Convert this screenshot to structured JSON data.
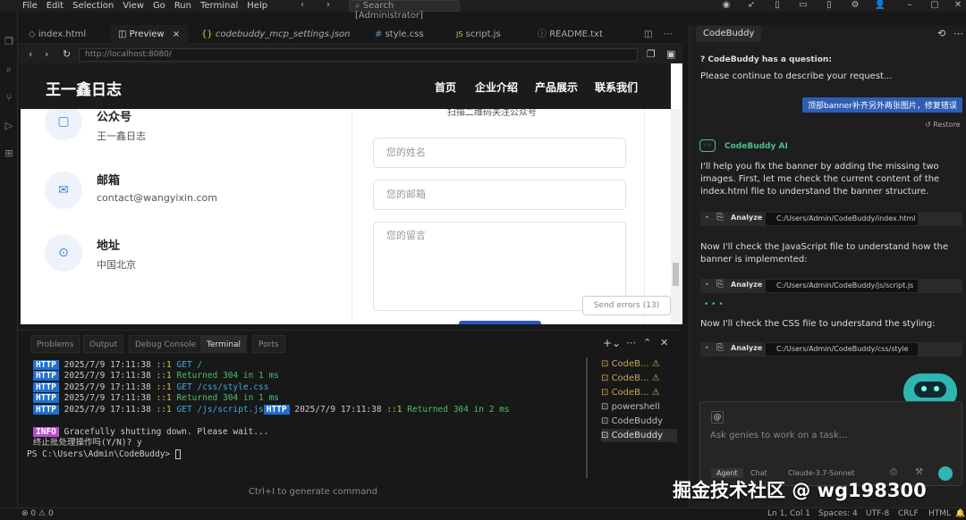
{
  "menu": [
    "File",
    "Edit",
    "Selection",
    "View",
    "Go",
    "Run",
    "Terminal",
    "Help"
  ],
  "search_text": "Search [Administrator]",
  "tabs": [
    {
      "icon": "◇",
      "label": "index.html",
      "close": ""
    },
    {
      "icon": "◫",
      "label": "Preview",
      "close": "×"
    },
    {
      "icon": "{}",
      "label": "codebuddy_mcp_settings.json",
      "close": ""
    },
    {
      "icon": "#",
      "label": "style.css",
      "close": ""
    },
    {
      "icon": "JS",
      "label": "script.js",
      "close": ""
    },
    {
      "icon": "ⓘ",
      "label": "README.txt",
      "close": ""
    }
  ],
  "url": "http://localhost:8080/",
  "site": {
    "logo": "王一鑫日志",
    "nav": [
      "首页",
      "企业介绍",
      "产品展示",
      "联系我们"
    ],
    "qr_caption": "扫描二维码关注公众号",
    "contacts": [
      {
        "title": "公众号",
        "value": "王一鑫日志",
        "icon": "▢"
      },
      {
        "title": "邮箱",
        "value": "contact@wangyixin.com",
        "icon": "✉"
      },
      {
        "title": "地址",
        "value": "中国北京",
        "icon": "⊙"
      }
    ],
    "placeholders": {
      "name": "您的姓名",
      "email": "您的邮箱",
      "message": "您的留言"
    },
    "send_errors": "Send errors (13)"
  },
  "panel": {
    "tabs": [
      "Problems",
      "Output",
      "Debug Console",
      "Terminal",
      "Ports"
    ],
    "hint": "Ctrl+I to generate command",
    "log": [
      {
        "badge": "HTTP",
        "time": "2025/7/9 17:11:38",
        "ip": "::1",
        "text": "GET /",
        "color": "#3ba7e0"
      },
      {
        "badge": "HTTP",
        "time": "2025/7/9 17:11:38",
        "ip": "::1",
        "text": "Returned 304 in 1 ms",
        "color": "#4cbf6a"
      },
      {
        "badge": "HTTP",
        "time": "2025/7/9 17:11:38",
        "ip": "::1",
        "text": "GET /css/style.css",
        "color": "#3ba7e0"
      },
      {
        "badge": "HTTP",
        "time": "2025/7/9 17:11:38",
        "ip": "::1",
        "text": "Returned 304 in 1 ms",
        "color": "#4cbf6a"
      },
      {
        "badge": "HTTP",
        "time": "2025/7/9 17:11:38",
        "ip": "::1",
        "text": "GET /js/script.js",
        "color": "#3ba7e0"
      }
    ],
    "log_extra": {
      "badge": "HTTP",
      "time": "2025/7/9 17:11:38",
      "ip": "::1",
      "text": "Returned 304 in 2 ms"
    },
    "info_badge": "INFO",
    "info_text": "Gracefully shutting down. Please wait...",
    "prompt_q": "终止批处理操作吗(Y/N)? y",
    "prompt": "PS C:\\Users\\Admin\\CodeBuddy> ",
    "terminals": [
      "CodeB...",
      "CodeB...",
      "CodeB...",
      "powershell",
      "CodeBuddy",
      "CodeBuddy"
    ]
  },
  "codebuddy": {
    "title": "CodeBuddy",
    "question": "CodeBuddy has a question:",
    "question_body": "Please continue to describe your request...",
    "user_msg": "顶部banner补齐另外两张图片，修复错误",
    "restore": "Restore",
    "ai_name": "CodeBuddy AI",
    "msg1": "I'll help you fix the banner by adding the missing two images. First, let me check the current content of the index.html file to understand the banner structure.",
    "analyze_label": "Analyze",
    "analyze": [
      "C:/Users/Admin/CodeBuddy/index.html",
      "C:/Users/Admin/CodeBuddy/js/script.js",
      "C:/Users/Admin/CodeBuddy/css/style"
    ],
    "msg2": "Now I'll check the JavaScript file to understand how the banner is implemented:",
    "msg3": "Now I'll check the CSS file to understand the styling:",
    "input_placeholder": "Ask genies to work on a task...",
    "input_btns": [
      "Agent",
      "Chat",
      "Claude-3.7-Sonnet"
    ]
  },
  "status": {
    "errors": "0",
    "warnings": "0",
    "position": "Ln 1, Col 1",
    "spaces": "Spaces: 4",
    "encoding": "UTF-8",
    "eol": "CRLF",
    "lang": "HTML"
  },
  "watermark": "掘金技术社区 @ wg198300"
}
